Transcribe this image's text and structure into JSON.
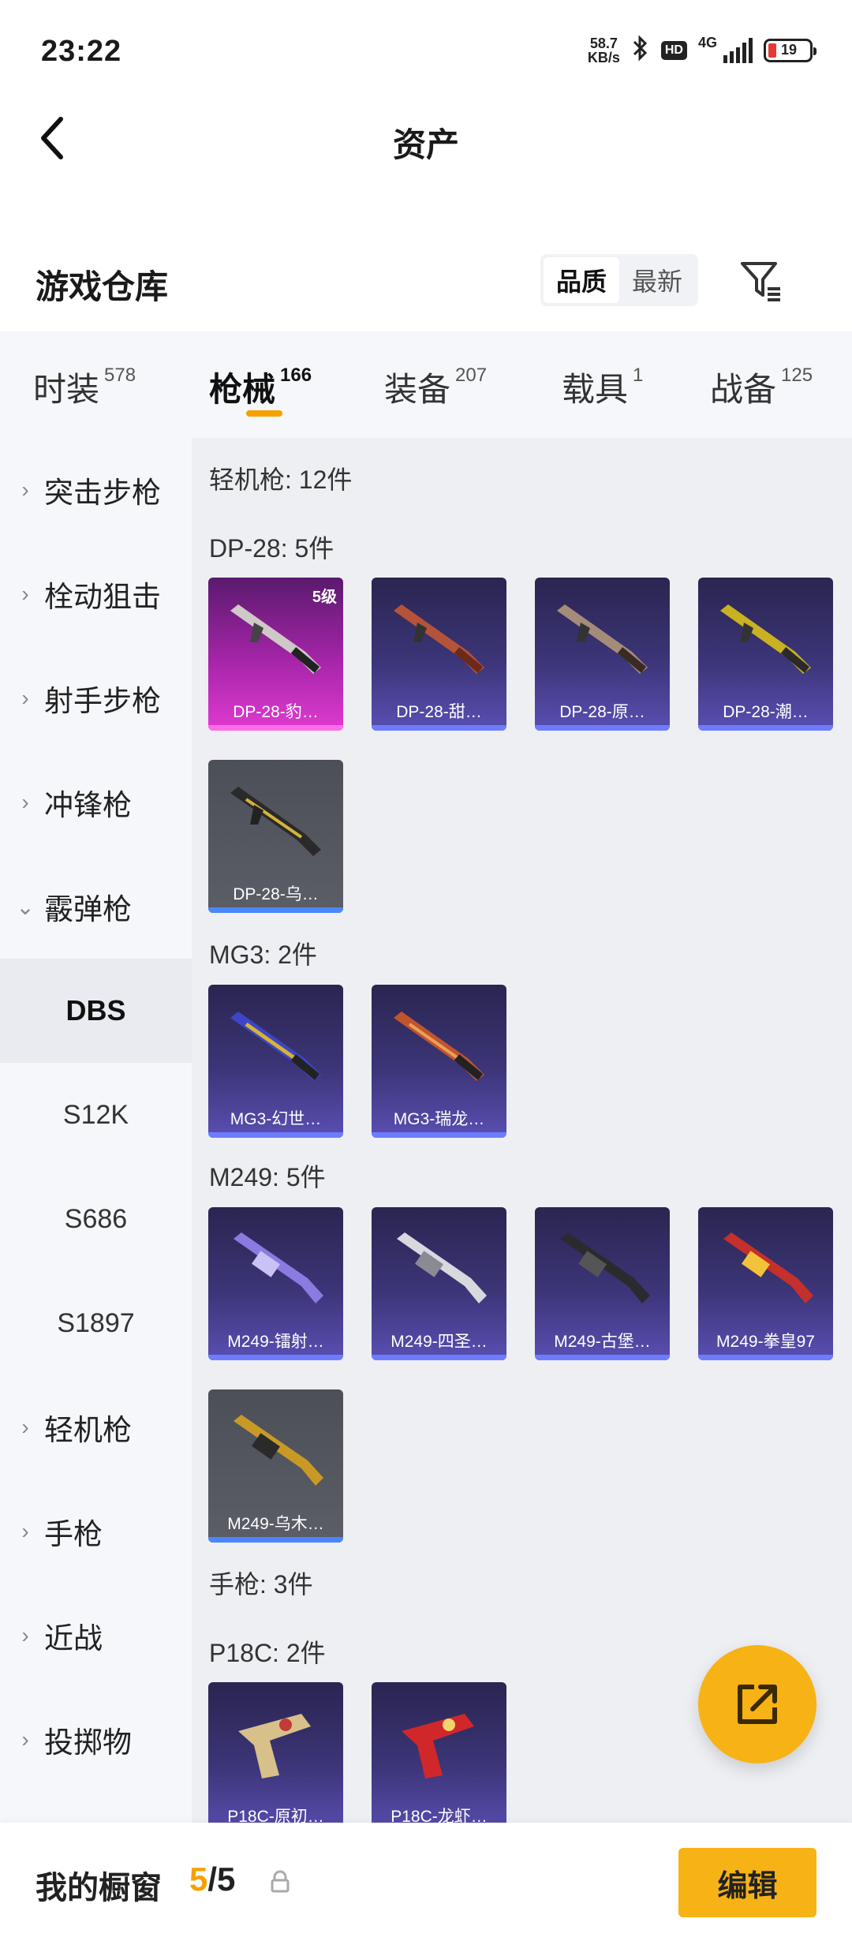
{
  "status": {
    "time": "23:22",
    "speed_value": "58.7",
    "speed_unit": "KB/s",
    "hd": "HD",
    "network": "4G",
    "battery": "19"
  },
  "nav": {
    "title": "资产"
  },
  "warehouse": {
    "title": "游戏仓库",
    "sort_quality": "品质",
    "sort_newest": "最新"
  },
  "tabs": [
    {
      "label": "时装",
      "count": "578"
    },
    {
      "label": "枪械",
      "count": "166"
    },
    {
      "label": "装备",
      "count": "207"
    },
    {
      "label": "载具",
      "count": "1"
    },
    {
      "label": "战备",
      "count": "125"
    }
  ],
  "sidebar": {
    "items": [
      {
        "label": "突击步枪"
      },
      {
        "label": "栓动狙击"
      },
      {
        "label": "射手步枪"
      },
      {
        "label": "冲锋枪"
      },
      {
        "label": "霰弹枪"
      }
    ],
    "subs": [
      {
        "label": "DBS"
      },
      {
        "label": "S12K"
      },
      {
        "label": "S686"
      },
      {
        "label": "S1897"
      }
    ],
    "items2": [
      {
        "label": "轻机枪"
      },
      {
        "label": "手枪"
      },
      {
        "label": "近战"
      },
      {
        "label": "投掷物"
      }
    ]
  },
  "content": {
    "lmg_header": "轻机枪: 12件",
    "dp28_header": "DP-28: 5件",
    "dp28": [
      {
        "name": "DP-28-豹…",
        "level": "5级"
      },
      {
        "name": "DP-28-甜…"
      },
      {
        "name": "DP-28-原…"
      },
      {
        "name": "DP-28-潮…"
      },
      {
        "name": "DP-28-乌…"
      }
    ],
    "mg3_header": "MG3: 2件",
    "mg3": [
      {
        "name": "MG3-幻世…"
      },
      {
        "name": "MG3-瑞龙…"
      }
    ],
    "m249_header": "M249: 5件",
    "m249": [
      {
        "name": "M249-镭射…"
      },
      {
        "name": "M249-四圣…"
      },
      {
        "name": "M249-古堡…"
      },
      {
        "name": "M249-拳皇97"
      },
      {
        "name": "M249-乌木…"
      }
    ],
    "pistol_header": "手枪: 3件",
    "p18c_header": "P18C: 2件",
    "p18c": [
      {
        "name": "P18C-原初…"
      },
      {
        "name": "P18C-龙虾…"
      }
    ]
  },
  "bottom": {
    "showcase_label": "我的橱窗",
    "showcase_current": "5",
    "showcase_total": "/5",
    "edit": "编辑"
  },
  "colors": {
    "accent": "#f7b215",
    "tab_underline": "#f5a000"
  }
}
